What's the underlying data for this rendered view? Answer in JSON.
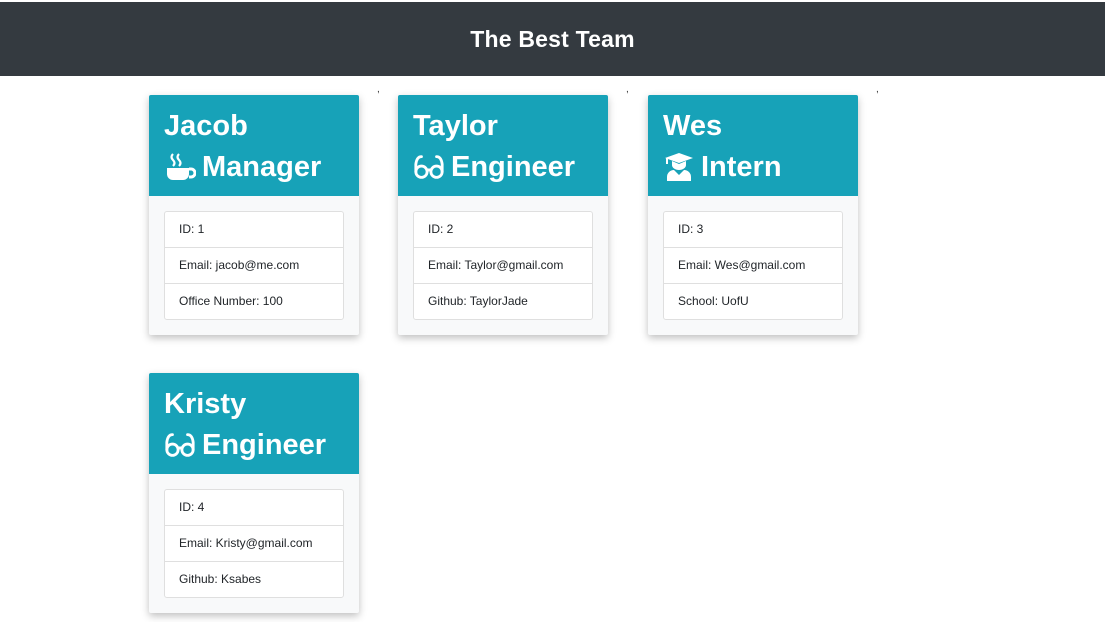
{
  "header": {
    "title": "The Best Team"
  },
  "separator": ",",
  "team": [
    {
      "name": "Jacob",
      "role": "Manager",
      "role_icon": "coffee-mug-icon",
      "details": [
        "ID: 1",
        "Email: jacob@me.com",
        "Office Number: 100"
      ]
    },
    {
      "name": "Taylor",
      "role": "Engineer",
      "role_icon": "glasses-icon",
      "details": [
        "ID: 2",
        "Email: Taylor@gmail.com",
        "Github: TaylorJade"
      ]
    },
    {
      "name": "Wes",
      "role": "Intern",
      "role_icon": "graduate-icon",
      "details": [
        "ID: 3",
        "Email: Wes@gmail.com",
        "School: UofU"
      ]
    },
    {
      "name": "Kristy",
      "role": "Engineer",
      "role_icon": "glasses-icon",
      "details": [
        "ID: 4",
        "Email: Kristy@gmail.com",
        "Github: Ksabes"
      ]
    }
  ],
  "colors": {
    "navbar": "#343a40",
    "card_header": "#17a2b8",
    "card_body": "#f8f9fa"
  }
}
